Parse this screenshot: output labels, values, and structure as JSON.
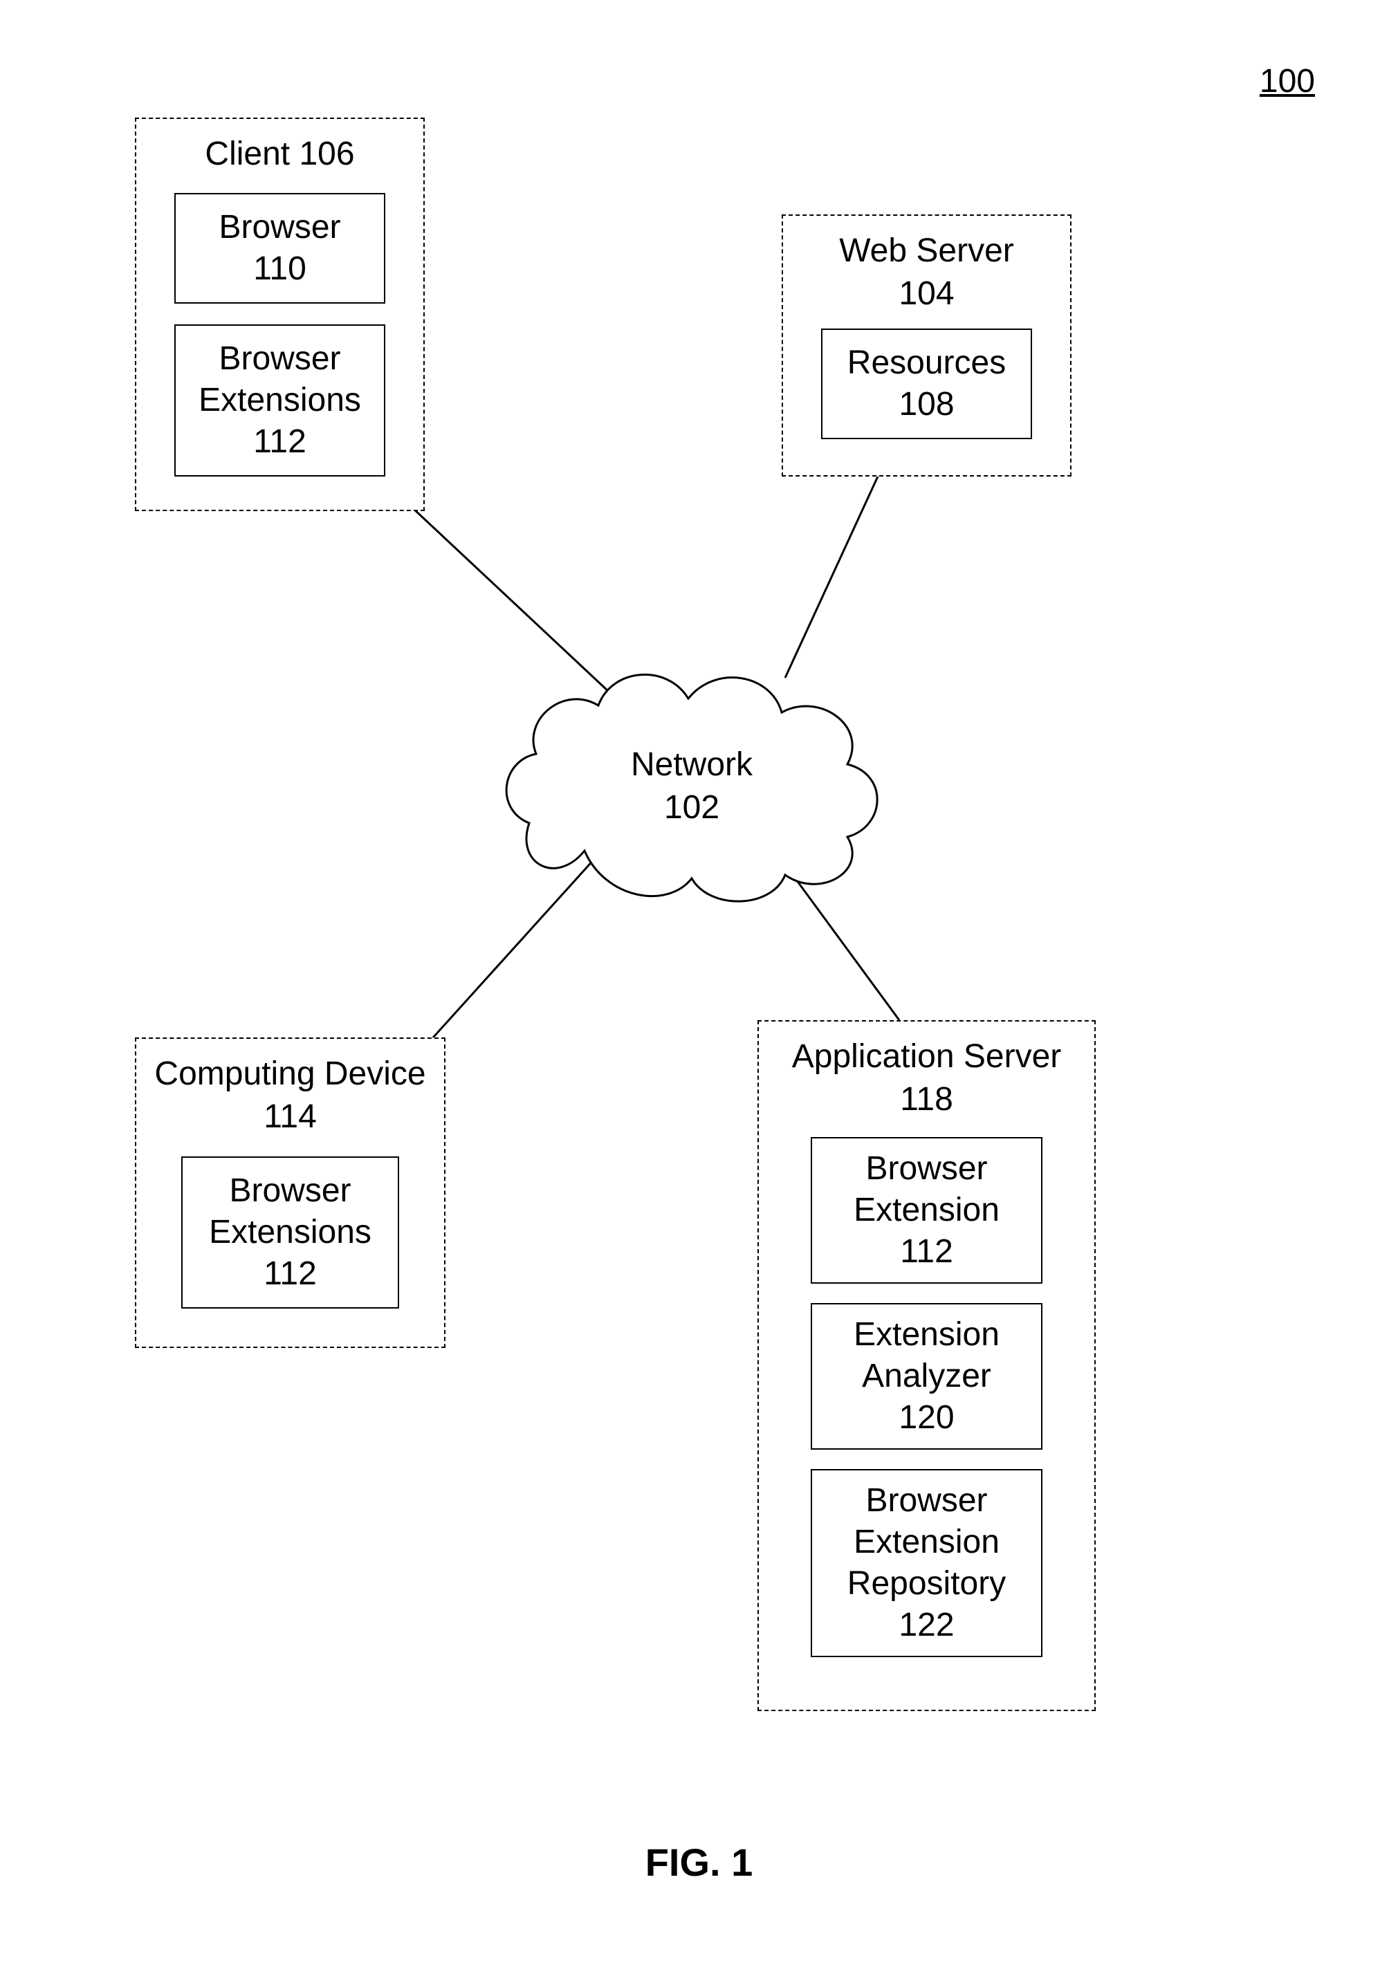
{
  "figure_number_label": "100",
  "figure_caption": "FIG. 1",
  "cloud": {
    "line1": "Network",
    "line2": "102"
  },
  "client": {
    "title_line1": "Client 106",
    "browser": {
      "line1": "Browser",
      "line2": "110"
    },
    "ext": {
      "line1": "Browser",
      "line2": "Extensions",
      "line3": "112"
    }
  },
  "webserver": {
    "title_line1": "Web Server",
    "title_line2": "104",
    "res": {
      "line1": "Resources",
      "line2": "108"
    }
  },
  "device": {
    "title_line1": "Computing Device",
    "title_line2": "114",
    "ext": {
      "line1": "Browser",
      "line2": "Extensions",
      "line3": "112"
    }
  },
  "appserver": {
    "title_line1": "Application Server",
    "title_line2": "118",
    "ext": {
      "line1": "Browser",
      "line2": "Extension",
      "line3": "112"
    },
    "ana": {
      "line1": "Extension",
      "line2": "Analyzer",
      "line3": "120"
    },
    "repo": {
      "line1": "Browser",
      "line2": "Extension",
      "line3": "Repository",
      "line4": "122"
    }
  }
}
